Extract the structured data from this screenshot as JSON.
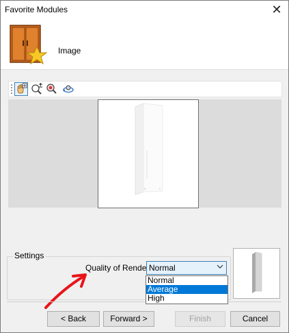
{
  "window": {
    "title": "Favorite Modules",
    "close_glyph": "✕"
  },
  "header": {
    "label": "Image",
    "icon": "wardrobe-star-icon"
  },
  "toolbar": {
    "buttons": [
      {
        "icon": "hand-pan-icon",
        "active": true
      },
      {
        "icon": "zoom-in-icon",
        "active": false
      },
      {
        "icon": "zoom-icon",
        "active": false
      },
      {
        "icon": "rotate-view-icon",
        "active": false
      }
    ]
  },
  "settings": {
    "legend": "Settings",
    "quality_label": "Quality of Render",
    "quality_value": "Normal",
    "options": [
      "Normal",
      "Average",
      "High"
    ],
    "highlighted_option": "Average"
  },
  "buttons": {
    "back": "< Back",
    "forward": "Forward >",
    "finish": "Finish",
    "cancel": "Cancel"
  },
  "colors": {
    "annotation_arrow": "#e8141b",
    "selection": "#0078d7",
    "select_focus": "#e5f1fb"
  }
}
